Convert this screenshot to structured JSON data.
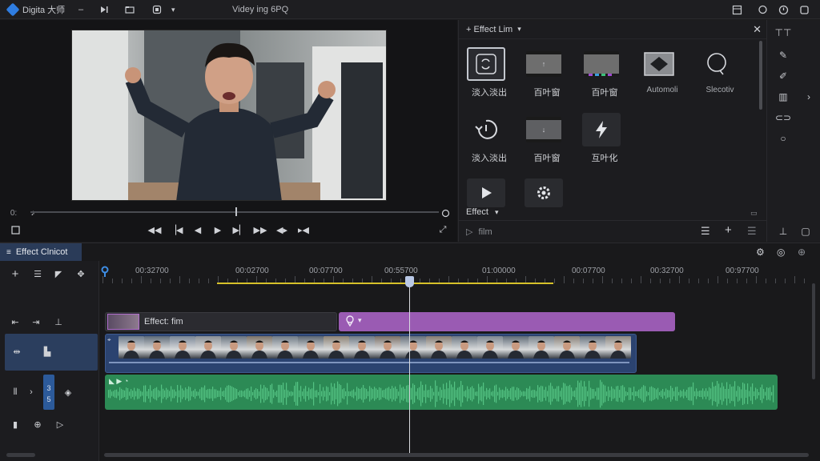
{
  "app": {
    "brand": "Digita 大师",
    "title": "Videy  ing 6PQ"
  },
  "effects_panel": {
    "header": "+  Effect Lim",
    "items": [
      {
        "label": "淡入淡出"
      },
      {
        "label": "百叶窗"
      },
      {
        "label": "百叶窗"
      },
      {
        "label": "Automoli"
      },
      {
        "label": "Slecotiv"
      },
      {
        "label": "淡入淡出"
      },
      {
        "label": "百叶窗"
      },
      {
        "label": "互叶化"
      }
    ],
    "footer_label": "Effect",
    "footer_sub": "film"
  },
  "preview": {
    "time_left": "0:"
  },
  "timeline": {
    "tab_label": "Effect Clnicot",
    "ruler_labels": [
      "00:32700",
      "00:02700",
      "00:07700",
      "00:55700",
      "01:00000",
      "00:07700",
      "00:32700",
      "00:97700"
    ],
    "effect_clip_label": "Effect: fim"
  },
  "colors": {
    "accent": "#2f7de1",
    "effect_clip": "#9a5bb3",
    "video_clip": "#2b4370",
    "audio_clip": "#2c8a55",
    "work_range": "#d6c12a"
  }
}
